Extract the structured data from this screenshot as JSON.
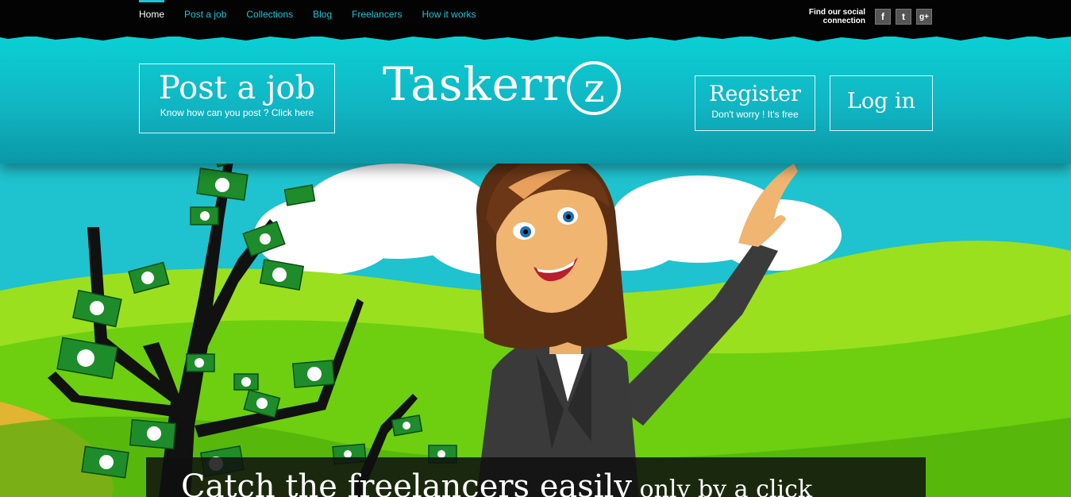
{
  "nav": {
    "items": [
      {
        "label": "Home",
        "active": true
      },
      {
        "label": "Post a job",
        "active": false
      },
      {
        "label": "Collections",
        "active": false
      },
      {
        "label": "Blog",
        "active": false
      },
      {
        "label": "Freelancers",
        "active": false
      },
      {
        "label": "How it works",
        "active": false
      }
    ]
  },
  "social": {
    "label_line1": "Find our social",
    "label_line2": "connection",
    "icons": [
      "facebook-icon",
      "twitter-icon",
      "google-plus-icon"
    ],
    "icon_glyphs": [
      "f",
      "t",
      "g+"
    ]
  },
  "header": {
    "post_job": {
      "title": "Post a job",
      "subtitle": "Know how can you post ? Click here"
    },
    "logo": {
      "text": "Taskerr",
      "badge": "z"
    },
    "register": {
      "title": "Register",
      "subtitle": "Don't worry ! It's free"
    },
    "login": {
      "title": "Log in"
    }
  },
  "tagline": {
    "main": "Catch the freelancers easily",
    "sub": " only by a click"
  },
  "colors": {
    "accent": "#19c6d6",
    "header": "#11b5c3",
    "grass": "#7ddc1a",
    "sky": "#1fc2cf"
  }
}
